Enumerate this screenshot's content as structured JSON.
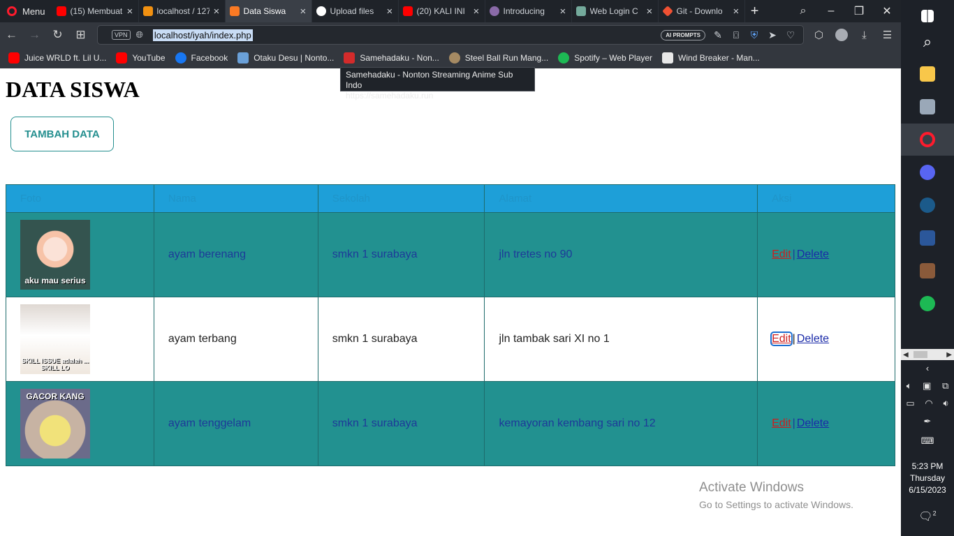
{
  "browser": {
    "menu_label": "Menu",
    "tabs": [
      {
        "label": "(15) Membuat",
        "icon": "youtube-icon",
        "color": "#ff0000",
        "active": false
      },
      {
        "label": "localhost / 127",
        "icon": "phpmyadmin-icon",
        "color": "#f29111",
        "active": false
      },
      {
        "label": "Data Siswa",
        "icon": "xampp-icon",
        "color": "#fb7a24",
        "active": true
      },
      {
        "label": "Upload files",
        "icon": "github-icon",
        "color": "#ffffff",
        "active": false
      },
      {
        "label": "(20) KALI INI",
        "icon": "youtube-icon",
        "color": "#ff0000",
        "active": false
      },
      {
        "label": "Introducing",
        "icon": "web-icon",
        "color": "#8a6aa8",
        "active": false
      },
      {
        "label": "Web Login C",
        "icon": "chatgpt-icon",
        "color": "#74aa9c",
        "active": false
      },
      {
        "label": "Git - Downlo",
        "icon": "git-icon",
        "color": "#f05133",
        "active": false
      }
    ],
    "url": "localhost/iyah/index.php",
    "vpn_label": "VPN",
    "ai_prompts_label": "AI PROMPTS",
    "bookmarks": [
      {
        "label": "Juice WRLD ft. Lil U...",
        "icon": "youtube-icon",
        "cls": "yt"
      },
      {
        "label": "YouTube",
        "icon": "youtube-icon",
        "cls": "yt"
      },
      {
        "label": "Facebook",
        "icon": "facebook-icon",
        "cls": "fb"
      },
      {
        "label": "Otaku Desu | Nonto...",
        "icon": "otakudesu-icon",
        "cls": "ot"
      },
      {
        "label": "Samehadaku - Non...",
        "icon": "samehadaku-icon",
        "cls": "sm"
      },
      {
        "label": "Steel Ball Run Mang...",
        "icon": "jojo-icon",
        "cls": "jj"
      },
      {
        "label": "Spotify – Web Player",
        "icon": "spotify-icon",
        "cls": "sp"
      },
      {
        "label": "Wind Breaker - Man...",
        "icon": "document-icon",
        "cls": "doc"
      }
    ],
    "tooltip": {
      "line1": "Samehadaku - Nonton Streaming Anime Sub Indo",
      "line2": "https://samehadaku.run"
    }
  },
  "page": {
    "title": "DATA SISWA",
    "add_button": "TAMBAH DATA",
    "table": {
      "headers": [
        "Foto",
        "Nama",
        "Sekolah",
        "Alamat",
        "Aksi"
      ],
      "rows": [
        {
          "photo_caption": "aku mau serius",
          "nama": "ayam berenang",
          "sekolah": "smkn 1 surabaya",
          "alamat": "jln tretes no 90",
          "edit": "Edit",
          "delete": "Delete"
        },
        {
          "photo_caption": "SKILL ISSUE adalah ... SKILL LO",
          "nama": "ayam terbang",
          "sekolah": "smkn 1 surabaya",
          "alamat": "jln tambak sari XI no 1",
          "edit": "Edit",
          "delete": "Delete"
        },
        {
          "photo_caption": "GACOR KANG",
          "nama": "ayam tenggelam",
          "sekolah": "smkn 1 surabaya",
          "alamat": "kemayoran kembang sari no 12",
          "edit": "Edit",
          "delete": "Delete"
        }
      ]
    },
    "separator": "|",
    "watermark": {
      "line1": "Activate Windows",
      "line2": "Go to Settings to activate Windows."
    }
  },
  "taskbar": {
    "apps": [
      {
        "name": "windows-start-icon",
        "color": "#ffffff"
      },
      {
        "name": "search-icon",
        "color": "#ffffff"
      },
      {
        "name": "file-explorer-icon",
        "color": "#f8c74a"
      },
      {
        "name": "remote-desktop-icon",
        "color": "#9aa8b8"
      },
      {
        "name": "opera-icon",
        "color": "#ff1b2d"
      },
      {
        "name": "discord-icon",
        "color": "#5865f2"
      },
      {
        "name": "steam-icon",
        "color": "#1b5a8a"
      },
      {
        "name": "word-icon",
        "color": "#2b579a"
      },
      {
        "name": "game-icon",
        "color": "#8a5a3a"
      },
      {
        "name": "spotify-icon",
        "color": "#1db954"
      }
    ],
    "clock": {
      "time": "5:23 PM",
      "day": "Thursday",
      "date": "6/15/2023"
    },
    "notification_count": "2"
  }
}
